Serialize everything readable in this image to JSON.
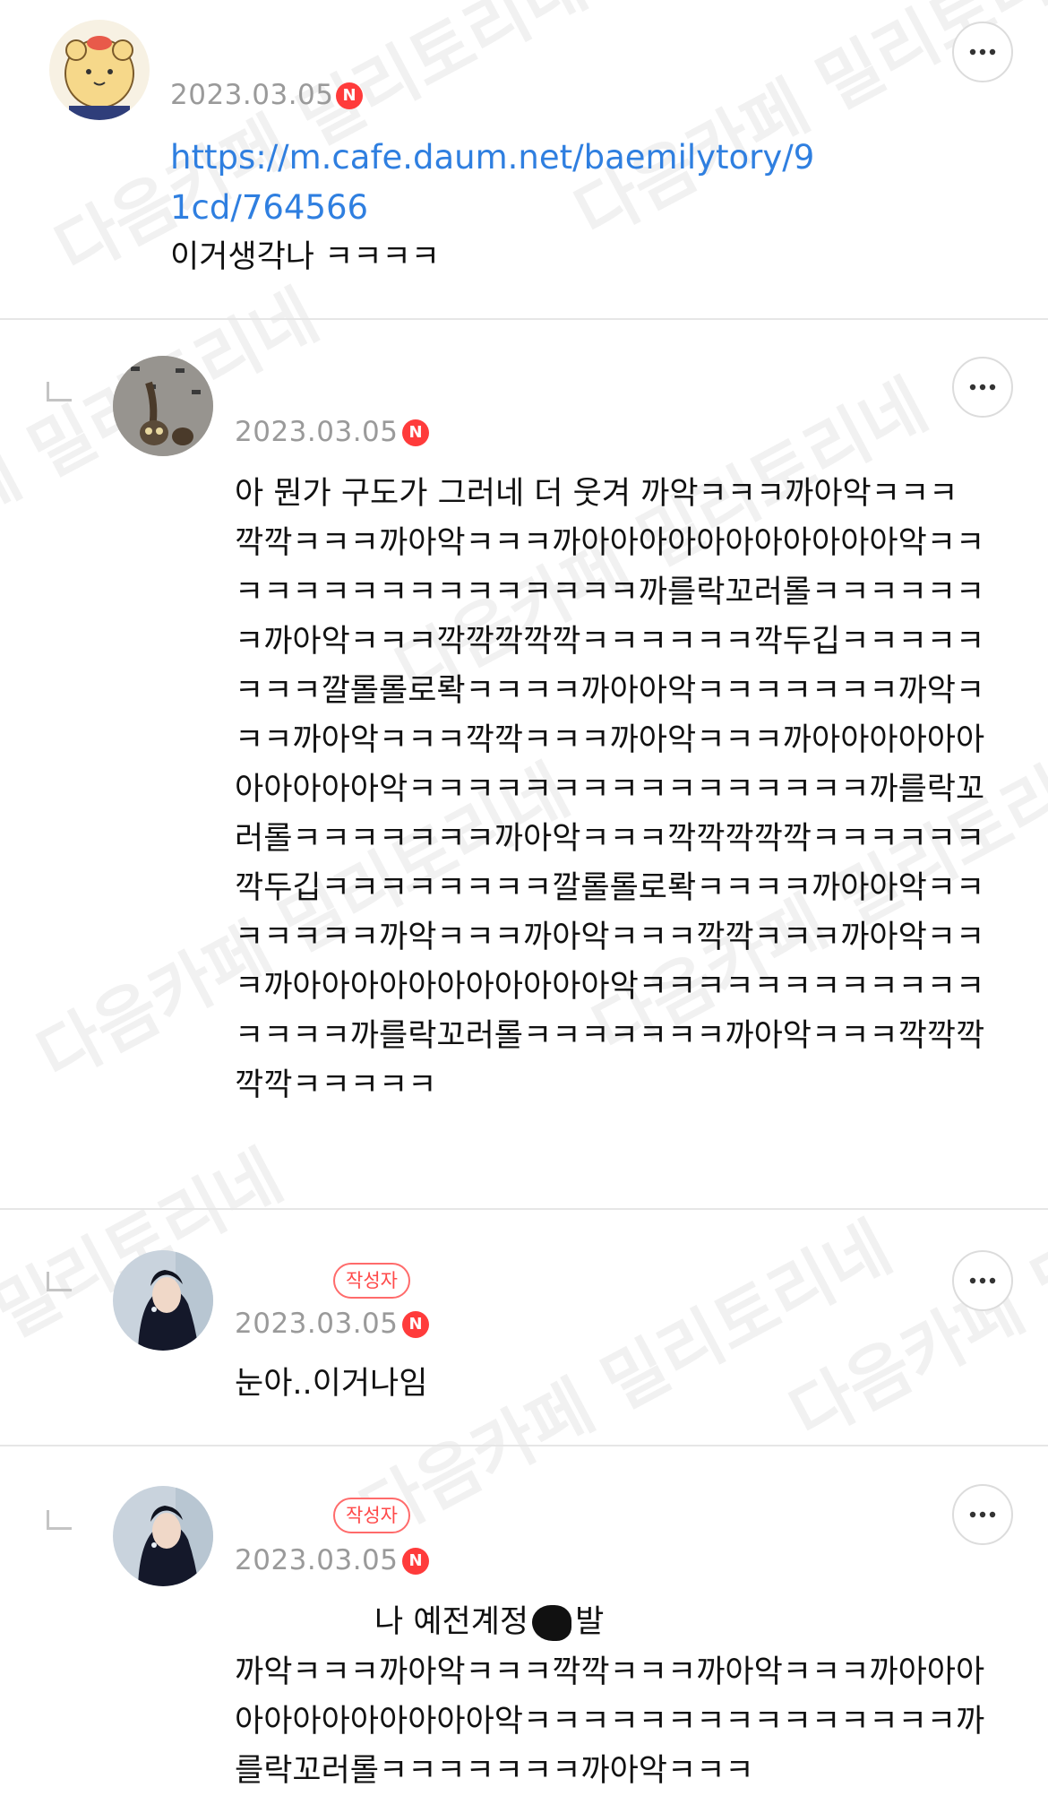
{
  "comments": [
    {
      "date": "2023.03.05",
      "badge": "N",
      "link": "https://m.cafe.daum.net/baemilytory/91cd/764566",
      "text": "이거생각나 ㅋㅋㅋㅋ"
    },
    {
      "date": "2023.03.05",
      "badge": "N",
      "text": "아 뭔가 구도가 그러네 더 웃겨 까악ㅋㅋㅋ까아악ㅋㅋㅋ깍깍ㅋㅋㅋ까아악ㅋㅋㅋ까아아아아아아아아아아아악ㅋㅋㅋㅋㅋㅋㅋㅋㅋㅋㅋㅋㅋㅋㅋㅋ까를락꼬러롤ㅋㅋㅋㅋㅋㅋㅋ까아악ㅋㅋㅋ깍깍깍깍깍ㅋㅋㅋㅋㅋㅋ깍두깁ㅋㅋㅋㅋㅋㅋㅋㅋ깔롤롤로롹ㅋㅋㅋㅋ까아아악ㅋㅋㅋㅋㅋㅋㅋ까악ㅋㅋㅋ까아악ㅋㅋㅋ깍깍ㅋㅋㅋ까아악ㅋㅋㅋ까아아아아아아아아아아아악ㅋㅋㅋㅋㅋㅋㅋㅋㅋㅋㅋㅋㅋㅋㅋㅋ까를락꼬러롤ㅋㅋㅋㅋㅋㅋㅋ까아악ㅋㅋㅋ깍깍깍깍깍ㅋㅋㅋㅋㅋㅋ깍두깁ㅋㅋㅋㅋㅋㅋㅋㅋ깔롤롤로롹ㅋㅋㅋㅋ까아아악ㅋㅋㅋㅋㅋㅋㅋ까악ㅋㅋㅋ까아악ㅋㅋㅋ깍깍ㅋㅋㅋ까아악ㅋㅋㅋ까아아아아아아아아아아아악ㅋㅋㅋㅋㅋㅋㅋㅋㅋㅋㅋㅋㅋㅋㅋㅋ까를락꼬러롤ㅋㅋㅋㅋㅋㅋㅋ까아악ㅋㅋㅋ깍깍깍깍깍ㅋㅋㅋㅋㅋ"
    },
    {
      "author_badge": "작성자",
      "date": "2023.03.05",
      "badge": "N",
      "text": "눈아..이거나임"
    },
    {
      "author_badge": "작성자",
      "date": "2023.03.05",
      "badge": "N",
      "text_first_before": "나 예전계정",
      "text_first_after": "발",
      "text_rest": "까악ㅋㅋㅋ까아악ㅋㅋㅋ깍깍ㅋㅋㅋ까아악ㅋㅋㅋ까아아아아아아아아아아아아악ㅋㅋㅋㅋㅋㅋㅋㅋㅋㅋㅋㅋㅋㅋㅋ까를락꼬러롤ㅋㅋㅋㅋㅋㅋㅋ까아악ㅋㅋㅋ"
    }
  ],
  "watermark": "다음카페 밀리토리네",
  "icons": {
    "more": "more-horizontal-icon",
    "reply": "reply-indent-icon"
  },
  "colors": {
    "link": "#2f7fe0",
    "new_badge": "#ff3b3b",
    "author_badge": "#ff4a4a",
    "date": "#9a9a9a"
  }
}
